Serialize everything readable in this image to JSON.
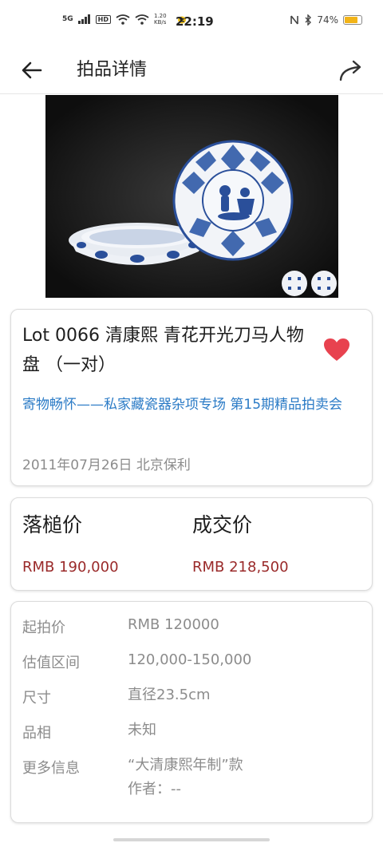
{
  "status_bar": {
    "network": "5G",
    "hd": "HD",
    "speed": "1.20 KB/s",
    "time": "22:19",
    "battery_text": "74%",
    "battery_level": 0.74
  },
  "app_bar": {
    "title": "拍品详情"
  },
  "lot": {
    "title": "Lot 0066 清康熙 青花开光刀马人物盘 （一对）",
    "session": "寄物畅怀——私家藏瓷器杂项专场 第15期精品拍卖会",
    "date_place": "2011年07月26日 北京保利",
    "favorite_color": "#e8424f"
  },
  "prices": {
    "hammer_label": "落槌价",
    "hammer_value": "RMB 190,000",
    "deal_label": "成交价",
    "deal_value": "RMB 218,500",
    "price_color": "#9a2a2a"
  },
  "details": [
    {
      "label": "起拍价",
      "value": "RMB 120000"
    },
    {
      "label": "估值区间",
      "value": "120,000-150,000"
    },
    {
      "label": "尺寸",
      "value": "直径23.5cm"
    },
    {
      "label": "品相",
      "value": "未知"
    },
    {
      "label": "更多信息",
      "value": "“大清康熙年制”款",
      "value2": "作者：--"
    }
  ],
  "colors": {
    "link": "#2b7bc6",
    "muted": "#8c8c8c"
  }
}
